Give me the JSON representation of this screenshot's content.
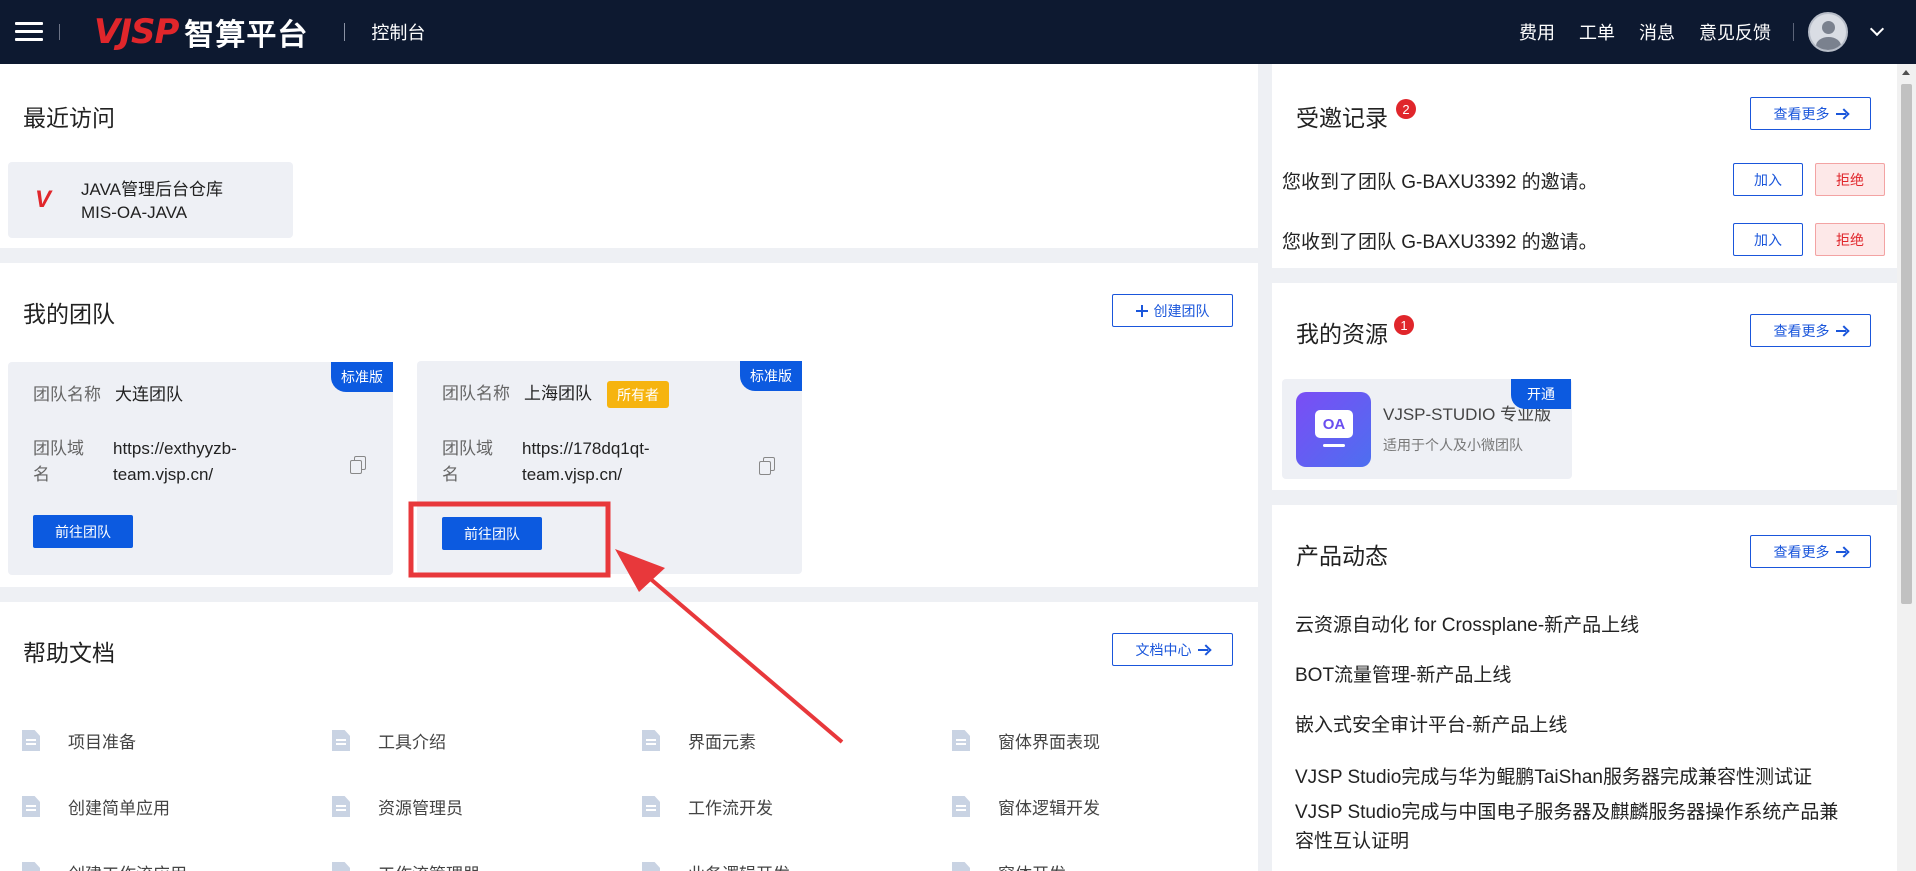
{
  "topbar": {
    "logo_mark": "VJSP",
    "logo_text": "智算平台",
    "console": "控制台",
    "links": [
      "费用",
      "工单",
      "消息",
      "意见反馈"
    ]
  },
  "recent": {
    "title": "最近访问",
    "item": {
      "name": "JAVA管理后台仓库",
      "code": "MIS-OA-JAVA",
      "icon_letter": "V"
    }
  },
  "teams": {
    "title": "我的团队",
    "create_label": "创建团队",
    "items": [
      {
        "ribbon": "标准版",
        "name_label": "团队名称",
        "name": "大连团队",
        "domain_label_1": "团队域",
        "domain_label_2": "名",
        "domain_1": "https://exthyyzb-",
        "domain_2": "team.vjsp.cn/",
        "go_label": "前往团队"
      },
      {
        "ribbon": "标准版",
        "name_label": "团队名称",
        "name": "上海团队",
        "owner_badge": "所有者",
        "domain_label_1": "团队域",
        "domain_label_2": "名",
        "domain_1": "https://178dq1qt-",
        "domain_2": "team.vjsp.cn/",
        "go_label": "前往团队"
      }
    ]
  },
  "docs": {
    "title": "帮助文档",
    "center_label": "文档中心",
    "items": [
      "项目准备",
      "工具介绍",
      "界面元素",
      "窗体界面表现",
      "创建简单应用",
      "资源管理员",
      "工作流开发",
      "窗体逻辑开发",
      "创建工作流应用",
      "工作流管理器",
      "业务逻辑开发",
      "窗体开发"
    ]
  },
  "invites": {
    "title": "受邀记录",
    "count": "2",
    "more_label": "查看更多",
    "items": [
      {
        "text": "您收到了团队 G-BAXU3392 的邀请。",
        "join": "加入",
        "reject": "拒绝"
      },
      {
        "text": "您收到了团队 G-BAXU3392 的邀请。",
        "join": "加入",
        "reject": "拒绝"
      }
    ]
  },
  "resources": {
    "title": "我的资源",
    "count": "1",
    "more_label": "查看更多",
    "item": {
      "icon_text": "OA",
      "name": "VJSP-STUDIO 专业版",
      "desc": "适用于个人及小微团队",
      "badge": "开通"
    }
  },
  "news": {
    "title": "产品动态",
    "more_label": "查看更多",
    "items": [
      "云资源自动化 for Crossplane-新产品上线",
      "BOT流量管理-新产品上线",
      "嵌入式安全审计平台-新产品上线",
      "VJSP Studio完成与华为鲲鹏TaiShan服务器完成兼容性测试证",
      "VJSP Studio完成与中国电子服务器及麒麟服务器操作系统产品兼",
      "容性互认证明"
    ]
  },
  "colors": {
    "primary": "#0c5ae0",
    "topbar": "#0d1930",
    "danger": "#e0262b",
    "owner": "#f6b40f",
    "annotation": "#e8383b"
  }
}
